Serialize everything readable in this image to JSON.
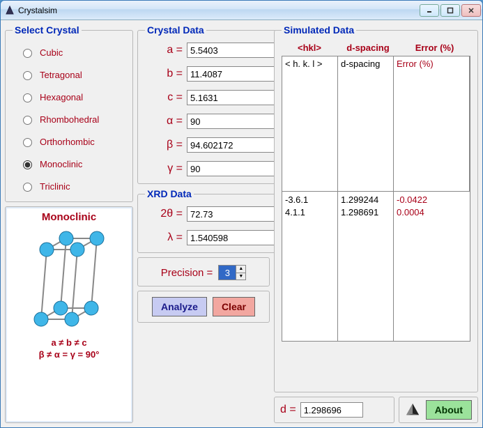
{
  "window": {
    "title": "Crystalsim"
  },
  "crystal_select": {
    "legend": "Select Crystal",
    "options": [
      "Cubic",
      "Tetragonal",
      "Hexagonal",
      "Rhombohedral",
      "Orthorhombic",
      "Monoclinic",
      "Triclinic"
    ],
    "selected": "Monoclinic"
  },
  "crystal_data": {
    "legend": "Crystal Data",
    "a_label": "a =",
    "a": "5.5403",
    "b_label": "b =",
    "b": "11.4087",
    "c_label": "c =",
    "c": "5.1631",
    "alpha_label": "α =",
    "alpha": "90",
    "beta_label": "β =",
    "beta": "94.602172",
    "gamma_label": "γ =",
    "gamma": "90"
  },
  "xrd_data": {
    "legend": "XRD Data",
    "two_theta_label": "2θ =",
    "two_theta": "72.73",
    "lambda_label": "λ =",
    "lambda": "1.540598"
  },
  "precision": {
    "label": "Precision =",
    "value": "3"
  },
  "buttons": {
    "analyze": "Analyze",
    "clear": "Clear",
    "about": "About"
  },
  "simulated": {
    "legend": "Simulated Data",
    "head_hkl": "<hkl>",
    "head_d": "d-spacing",
    "head_err": "Error (%)",
    "col_hkl": "< h. k. l >",
    "col_d": "d-spacing",
    "col_err": "Error (%)",
    "values_hkl": "-3.6.1\n4.1.1",
    "values_d": "1.299244\n1.298691",
    "values_err": "-0.0422\n0.0004"
  },
  "d_output": {
    "label": "d =",
    "value": "1.298696"
  },
  "structure_panel": {
    "title": "Monoclinic",
    "formula_line1": "a ≠ b ≠ c",
    "formula_line2": "β ≠ α = γ = 90°"
  }
}
